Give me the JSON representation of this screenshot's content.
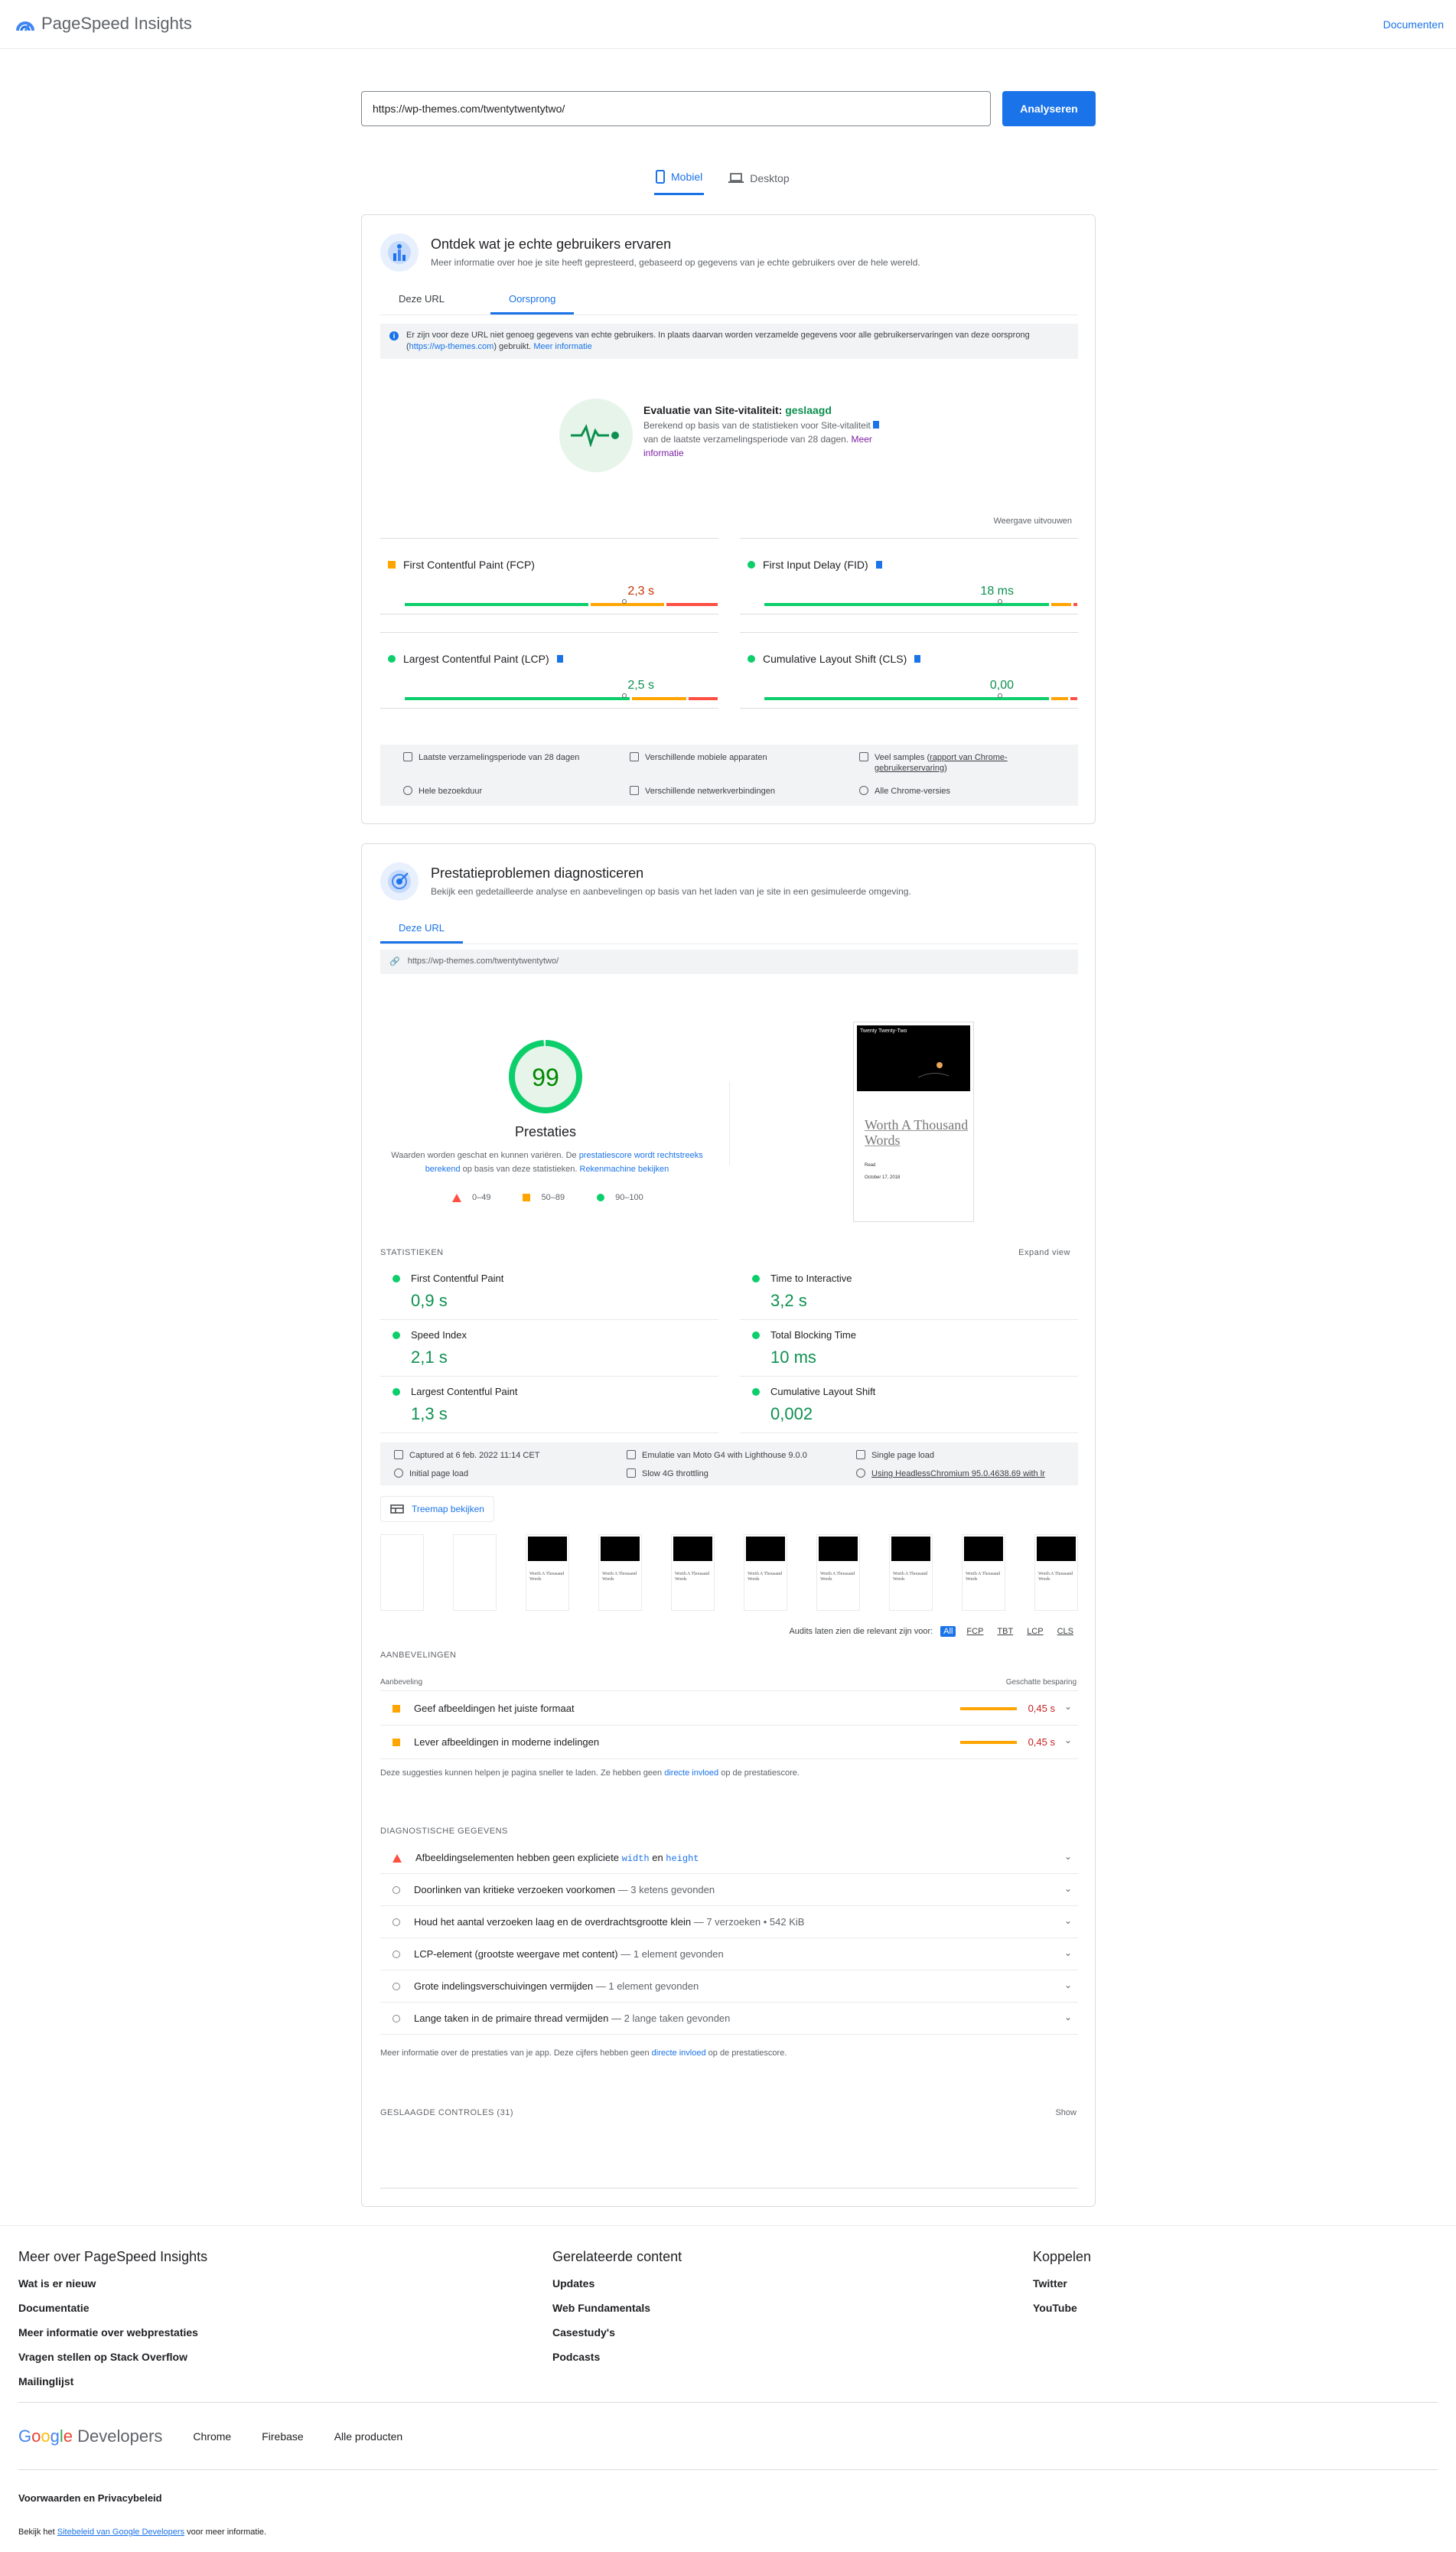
{
  "header": {
    "title": "PageSpeed Insights",
    "docs_label": "Documenten"
  },
  "search": {
    "url": "https://wp-themes.com/twentytwentytwo/",
    "analyze_label": "Analyseren"
  },
  "device_tabs": [
    {
      "label": "Mobiel",
      "active": true
    },
    {
      "label": "Desktop",
      "active": false
    }
  ],
  "field": {
    "title": "Ontdek wat je echte gebruikers ervaren",
    "subtitle": "Meer informatie over hoe je site heeft gepresteerd, gebaseerd op gegevens van je echte gebruikers over de hele wereld.",
    "tabs": [
      {
        "label": "Deze URL",
        "active": false
      },
      {
        "label": "Oorsprong",
        "active": true
      }
    ],
    "banner_text": "Er zijn voor deze URL niet genoeg gegevens van echte gebruikers. In plaats daarvan worden verzamelde gegevens voor alle gebruikerservaringen van deze oorsprong (",
    "banner_link": "https://wp-themes.com",
    "banner_text2": ") gebruikt.",
    "banner_more": "Meer informatie",
    "vitals_title": "Evaluatie van Site-vitaliteit:",
    "vitals_status": "geslaagd",
    "vitals_desc1": "Berekend op basis van de statistieken voor Site-vitaliteit",
    "vitals_desc2": "van de laatste verzamelingsperiode van 28 dagen.",
    "vitals_more": "Meer informatie",
    "expand_label": "Weergave uitvouwen",
    "metrics": [
      {
        "name": "First Contentful Paint (FCP)",
        "value": "2,3 s",
        "status": "average",
        "flag": false,
        "good": 0.59,
        "avg": 0.24,
        "poor": 0.17,
        "marker": 0.69
      },
      {
        "name": "First Input Delay (FID)",
        "value": "18 ms",
        "status": "good",
        "flag": true,
        "good": 0.91,
        "avg": 0.07,
        "poor": 0.02,
        "marker": 0.74
      },
      {
        "name": "Largest Contentful Paint (LCP)",
        "value": "2,5 s",
        "status": "good",
        "flag": true,
        "good": 0.72,
        "avg": 0.18,
        "poor": 0.1,
        "marker": 0.69
      },
      {
        "name": "Cumulative Layout Shift (CLS)",
        "value": "0,00",
        "status": "good",
        "flag": true,
        "good": 0.91,
        "avg": 0.06,
        "poor": 0.03,
        "marker": 0.74
      }
    ],
    "info": [
      {
        "text": "Laatste verzamelingsperiode van 28 dagen",
        "link": ""
      },
      {
        "text": "Verschillende mobiele apparaten",
        "link": ""
      },
      {
        "text": "Veel samples (",
        "link": "rapport van Chrome-gebruikerservaring",
        "after": ")"
      },
      {
        "text": "Hele bezoekduur",
        "link": ""
      },
      {
        "text": "Verschillende netwerkverbindingen",
        "link": ""
      },
      {
        "text": "Alle Chrome-versies",
        "link": ""
      }
    ]
  },
  "lab": {
    "title": "Prestatieproblemen diagnosticeren",
    "subtitle": "Bekijk een gedetailleerde analyse en aanbevelingen op basis van het laden van je site in een gesimuleerde omgeving.",
    "tab": "Deze URL",
    "tested_url": "https://wp-themes.com/twentytwentytwo/",
    "score": "99",
    "score_fraction": 0.99,
    "score_label": "Prestaties",
    "score_note1": "Waarden worden geschat en kunnen variëren. De ",
    "score_note_link": "prestatiescore wordt rechtstreeks berekend",
    "score_note2": " op basis van deze statistieken. ",
    "score_note_link2": "Rekenmachine bekijken",
    "legend": [
      "0–49",
      "50–89",
      "90–100"
    ],
    "screenshot": {
      "site": "Twenty Twenty-Two",
      "heading": "Worth A Thousand Words",
      "meta1": "Read",
      "meta2": "October 17, 2018"
    },
    "stats_label": "STATISTIEKEN",
    "expand_label": "Expand view",
    "stats": [
      {
        "name": "First Contentful Paint",
        "value": "0,9 s"
      },
      {
        "name": "Time to Interactive",
        "value": "3,2 s"
      },
      {
        "name": "Speed Index",
        "value": "2,1 s"
      },
      {
        "name": "Total Blocking Time",
        "value": "10 ms"
      },
      {
        "name": "Largest Contentful Paint",
        "value": "1,3 s"
      },
      {
        "name": "Cumulative Layout Shift",
        "value": "0,002"
      }
    ],
    "env": [
      "Captured at 6 feb. 2022 11:14 CET",
      "Emulatie van Moto G4 with Lighthouse 9.0.0",
      "Single page load",
      "Initial page load",
      "Slow 4G throttling",
      "Using HeadlessChromium 95.0.4638.69 with lr"
    ],
    "treemap_label": "Treemap bekijken",
    "filmstrip_heading": "Worth A Thousand Words",
    "filter_label": "Audits laten zien die relevant zijn voor:",
    "filters": [
      "All",
      "FCP",
      "TBT",
      "LCP",
      "CLS"
    ],
    "opp_label": "AANBEVELINGEN",
    "opp_col1": "Aanbeveling",
    "opp_col2": "Geschatte besparing",
    "opportunities": [
      {
        "title": "Geef afbeeldingen het juiste formaat",
        "value": "0,45 s"
      },
      {
        "title": "Lever afbeeldingen in moderne indelingen",
        "value": "0,45 s"
      }
    ],
    "opp_note1": "Deze suggesties kunnen helpen je pagina sneller te laden. Ze hebben geen ",
    "opp_note_link": "directe invloed",
    "opp_note2": " op de prestatiescore.",
    "diag_label": "DIAGNOSTISCHE GEGEVENS",
    "diag_first": {
      "t1": "Afbeeldingselementen hebben geen expliciete ",
      "c1": "width",
      "t2": " en ",
      "c2": "height"
    },
    "diagnostics": [
      {
        "title": "Doorlinken van kritieke verzoeken voorkomen",
        "detail": "— 3 ketens gevonden"
      },
      {
        "title": "Houd het aantal verzoeken laag en de overdrachtsgrootte klein",
        "detail": "— 7 verzoeken • 542 KiB"
      },
      {
        "title": "LCP-element (grootste weergave met content)",
        "detail": "— 1 element gevonden"
      },
      {
        "title": "Grote indelingsverschuivingen vermijden",
        "detail": "— 1 element gevonden"
      },
      {
        "title": "Lange taken in de primaire thread vermijden",
        "detail": "— 2 lange taken gevonden"
      }
    ],
    "diag_note1": "Meer informatie over de prestaties van je app. Deze cijfers hebben geen ",
    "diag_note_link": "directe invloed",
    "diag_note2": " op de prestatiescore.",
    "passed_label": "GESLAAGDE CONTROLES (31)",
    "show_label": "Show"
  },
  "footer": {
    "col1_title": "Meer over PageSpeed Insights",
    "col1_links": [
      "Wat is er nieuw",
      "Documentatie",
      "Meer informatie over webprestaties",
      "Vragen stellen op Stack Overflow",
      "Mailinglijst"
    ],
    "col2_title": "Gerelateerde content",
    "col2_links": [
      "Updates",
      "Web Fundamentals",
      "Casestudy's",
      "Podcasts"
    ],
    "col3_title": "Koppelen",
    "col3_links": [
      "Twitter",
      "YouTube"
    ],
    "brand_word": "Developers",
    "products": [
      "Chrome",
      "Firebase",
      "Alle producten"
    ],
    "terms": "Voorwaarden en Privacybeleid",
    "policy1": "Bekijk het ",
    "policy_link": "Sitebeleid van Google Developers",
    "policy2": " voor meer informatie."
  },
  "colors": {
    "accent": "#1a73e8",
    "good": "#0cce6b",
    "average": "#ffa400",
    "poor": "#ff4e42"
  }
}
